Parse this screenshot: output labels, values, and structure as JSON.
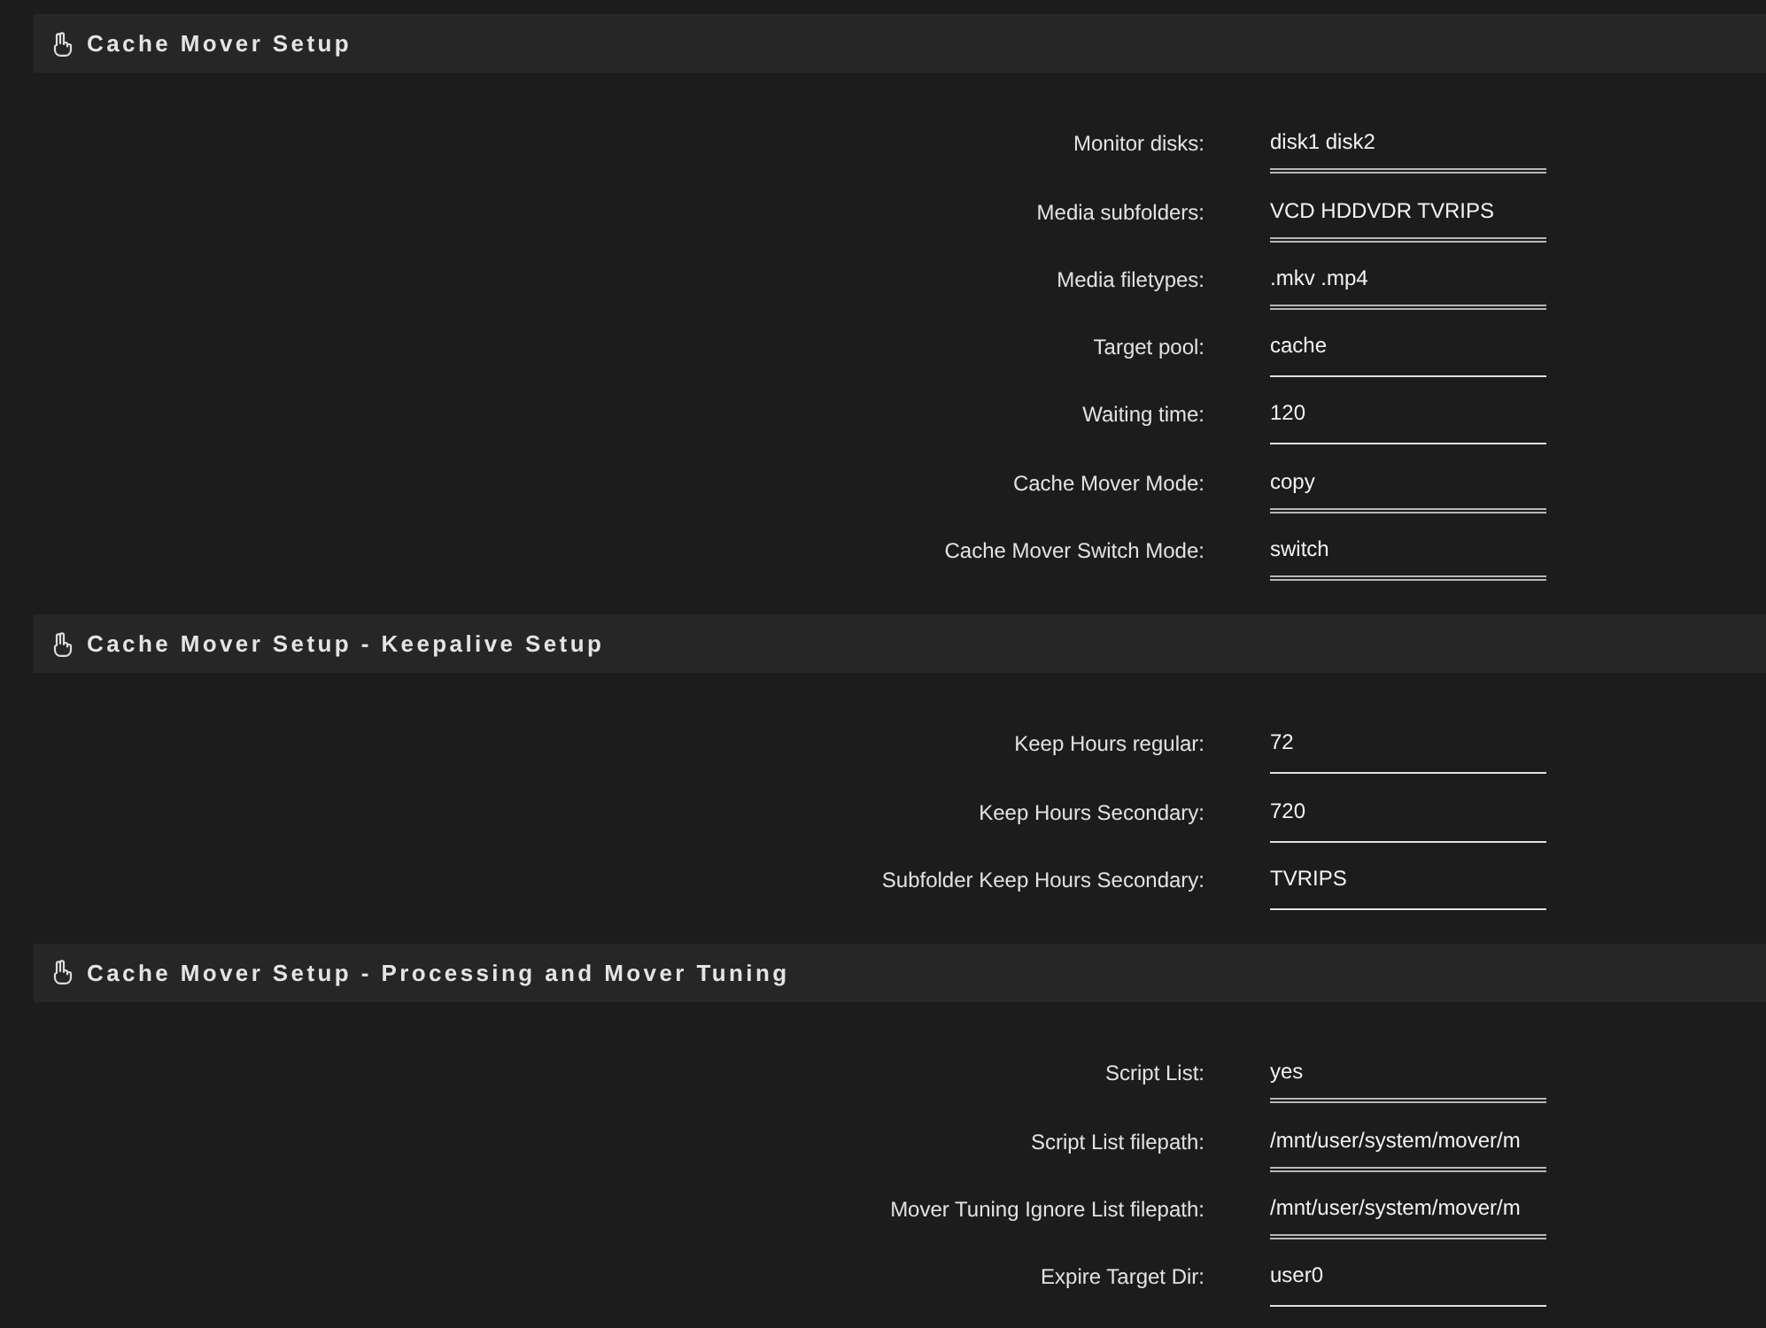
{
  "sections": [
    {
      "title": "Cache Mover Setup",
      "fields": [
        {
          "label": "Monitor disks:",
          "value": "disk1 disk2",
          "kind": "select"
        },
        {
          "label": "Media subfolders:",
          "value": "VCD HDDVDR TVRIPS",
          "kind": "select"
        },
        {
          "label": "Media filetypes:",
          "value": ".mkv .mp4",
          "kind": "select"
        },
        {
          "label": "Target pool:",
          "value": "cache",
          "kind": "text"
        },
        {
          "label": "Waiting time:",
          "value": "120",
          "kind": "text"
        },
        {
          "label": "Cache Mover Mode:",
          "value": "copy",
          "kind": "select"
        },
        {
          "label": "Cache Mover Switch Mode:",
          "value": "switch",
          "kind": "select"
        }
      ]
    },
    {
      "title": "Cache Mover Setup - Keepalive Setup",
      "fields": [
        {
          "label": "Keep Hours regular:",
          "value": "72",
          "kind": "text"
        },
        {
          "label": "Keep Hours Secondary:",
          "value": "720",
          "kind": "text"
        },
        {
          "label": "Subfolder Keep Hours Secondary:",
          "value": "TVRIPS",
          "kind": "text"
        }
      ]
    },
    {
      "title": "Cache Mover Setup - Processing and Mover Tuning",
      "fields": [
        {
          "label": "Script List:",
          "value": "yes",
          "kind": "select"
        },
        {
          "label": "Script List filepath:",
          "value": "/mnt/user/system/mover/m",
          "kind": "select"
        },
        {
          "label": "Mover Tuning Ignore List filepath:",
          "value": "/mnt/user/system/mover/m",
          "kind": "select"
        },
        {
          "label": "Expire Target Dir:",
          "value": "user0",
          "kind": "text"
        }
      ]
    }
  ]
}
